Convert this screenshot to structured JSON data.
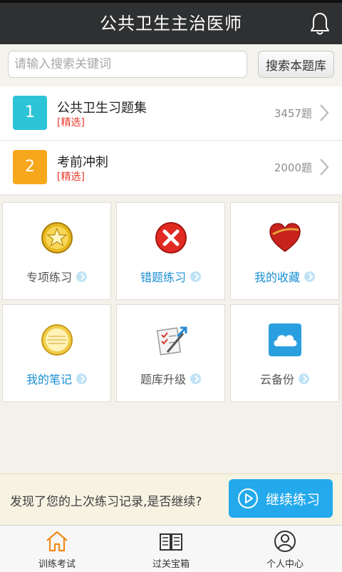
{
  "header": {
    "title": "公共卫生主治医师",
    "bell_icon": "bell-icon"
  },
  "search": {
    "placeholder": "请输入搜索关键词",
    "value": "",
    "button_label": "搜索本题库"
  },
  "question_banks": [
    {
      "number": "1",
      "name": "公共卫生习题集",
      "tag": "[精选]",
      "count": "3457题",
      "color": "#2ec4d8"
    },
    {
      "number": "2",
      "name": "考前冲刺",
      "tag": "[精选]",
      "count": "2000题",
      "color": "#f7a71b"
    }
  ],
  "features": [
    {
      "label": "专项练习",
      "icon": "star-medal-icon"
    },
    {
      "label": "错题练习",
      "icon": "error-x-icon"
    },
    {
      "label": "我的收藏",
      "icon": "heart-icon"
    },
    {
      "label": "我的笔记",
      "icon": "notepad-icon"
    },
    {
      "label": "题库升级",
      "icon": "checklist-pen-icon"
    },
    {
      "label": "云备份",
      "icon": "cloud-icon"
    }
  ],
  "resume": {
    "message": "发现了您的上次练习记录,是否继续?",
    "button_label": "继续练习"
  },
  "bottom_nav": [
    {
      "label": "训练考试",
      "icon": "home-icon",
      "active": true
    },
    {
      "label": "过关宝箱",
      "icon": "book-icon",
      "active": false
    },
    {
      "label": "个人中心",
      "icon": "user-icon",
      "active": false
    }
  ],
  "colors": {
    "header_bg": "#2f3031",
    "accent_blue": "#23a9ec",
    "link_blue": "#1a8fd3",
    "tag_red": "#e83a2e",
    "nav_active": "#f08a1c"
  }
}
